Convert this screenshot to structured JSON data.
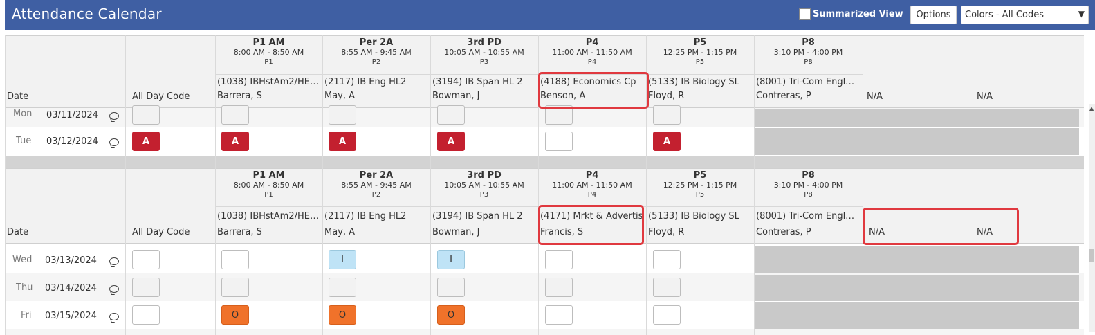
{
  "app": {
    "title": "Attendance Calendar",
    "summarized_view_label": "Summarized View",
    "options_label": "Options",
    "colors_select_value": "Colors - All Codes",
    "accent_color": "#3f5fa3"
  },
  "columns": {
    "date_label": "Date",
    "all_day_label": "All Day Code"
  },
  "periods": [
    {
      "name": "P1 AM",
      "time": "8:00 AM - 8:50 AM",
      "code": "P1"
    },
    {
      "name": "Per 2A",
      "time": "8:55 AM - 9:45 AM",
      "code": "P2"
    },
    {
      "name": "3rd PD",
      "time": "10:05 AM - 10:55 AM",
      "code": "P3"
    },
    {
      "name": "P4",
      "time": "11:00 AM - 11:50 AM",
      "code": "P4"
    },
    {
      "name": "P5",
      "time": "12:25 PM - 1:15 PM",
      "code": "P5"
    },
    {
      "name": "P8",
      "time": "3:10 PM - 4:00 PM",
      "code": "P8"
    }
  ],
  "block1": {
    "courses": [
      {
        "course": "(1038) IBHstAm2/HE…",
        "teacher": "Barrera, S"
      },
      {
        "course": "(2117) IB Eng HL2",
        "teacher": "May, A"
      },
      {
        "course": "(3194) IB Span HL 2",
        "teacher": "Bowman, J"
      },
      {
        "course": "(4188) Economics Cp",
        "teacher": "Benson, A"
      },
      {
        "course": "(5133) IB Biology SL",
        "teacher": "Floyd, R"
      },
      {
        "course": "(8001) Tri-Com Engl…",
        "teacher": "Contreras, P"
      }
    ],
    "na1": "N/A",
    "na2": "N/A",
    "rows": [
      {
        "day": "Mon",
        "date": "03/11/2024"
      },
      {
        "day": "Tue",
        "date": "03/12/2024",
        "allday": "",
        "codes": [
          "A",
          "A",
          "A",
          "",
          "A"
        ]
      }
    ]
  },
  "block2": {
    "courses": [
      {
        "course": "(1038) IBHstAm2/HE…",
        "teacher": "Barrera, S"
      },
      {
        "course": "(2117) IB Eng HL2",
        "teacher": "May, A"
      },
      {
        "course": "(3194) IB Span HL 2",
        "teacher": "Bowman, J"
      },
      {
        "course": "(4171) Mrkt & Advertis",
        "teacher": "Francis, S"
      },
      {
        "course": "(5133) IB Biology SL",
        "teacher": "Floyd, R"
      },
      {
        "course": "(8001) Tri-Com Engl…",
        "teacher": "Contreras, P"
      }
    ],
    "na1": "N/A",
    "na2": "N/A",
    "rows": [
      {
        "day": "Wed",
        "date": "03/13/2024",
        "codes": [
          "",
          "I",
          "I",
          "",
          ""
        ]
      },
      {
        "day": "Thu",
        "date": "03/14/2024",
        "codes": [
          "",
          "",
          "",
          "",
          ""
        ]
      },
      {
        "day": "Fri",
        "date": "03/15/2024",
        "codes": [
          "O",
          "O",
          "O",
          "",
          ""
        ]
      }
    ]
  },
  "code_colors": {
    "A": "#c3202f",
    "I": "#bfe3f6",
    "O": "#f0722a",
    "highlight": "#e0393f"
  }
}
